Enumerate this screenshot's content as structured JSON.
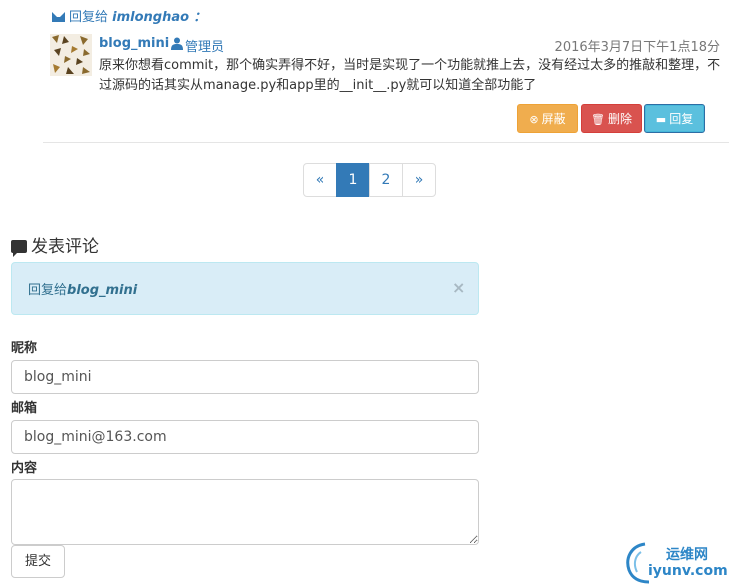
{
  "reply_header": {
    "prefix": "回复给",
    "to_name": "imlonghao",
    "suffix": "："
  },
  "comment": {
    "author": "blog_mini",
    "role": "管理员",
    "time": "2016年3月7日下午1点18分",
    "body": "原来你想看commit，那个确实弄得不好，当时是实现了一个功能就推上去，没有经过太多的推敲和整理，不过源码的话其实从manage.py和app里的__init__.py就可以知道全部功能了",
    "buttons": {
      "mask": "屏蔽",
      "delete": "删除",
      "reply": "回复"
    },
    "colors": {
      "mask": "#f0ad4e",
      "delete": "#d9534f",
      "reply": "#5bc0de"
    }
  },
  "pagination": {
    "prev": "«",
    "pages": [
      "1",
      "2"
    ],
    "active": "1",
    "next": "»"
  },
  "post_comment": {
    "title": "发表评论",
    "alert": {
      "prefix": "回复给",
      "name": "blog_mini",
      "close": "×"
    },
    "nickname_label": "昵称",
    "nickname_value": "blog_mini",
    "email_label": "邮箱",
    "email_value": "blog_mini@163.com",
    "content_label": "内容",
    "content_value": "",
    "submit_label": "提交"
  },
  "watermark": {
    "line1": "运维网",
    "line2": "iyunv.com"
  }
}
